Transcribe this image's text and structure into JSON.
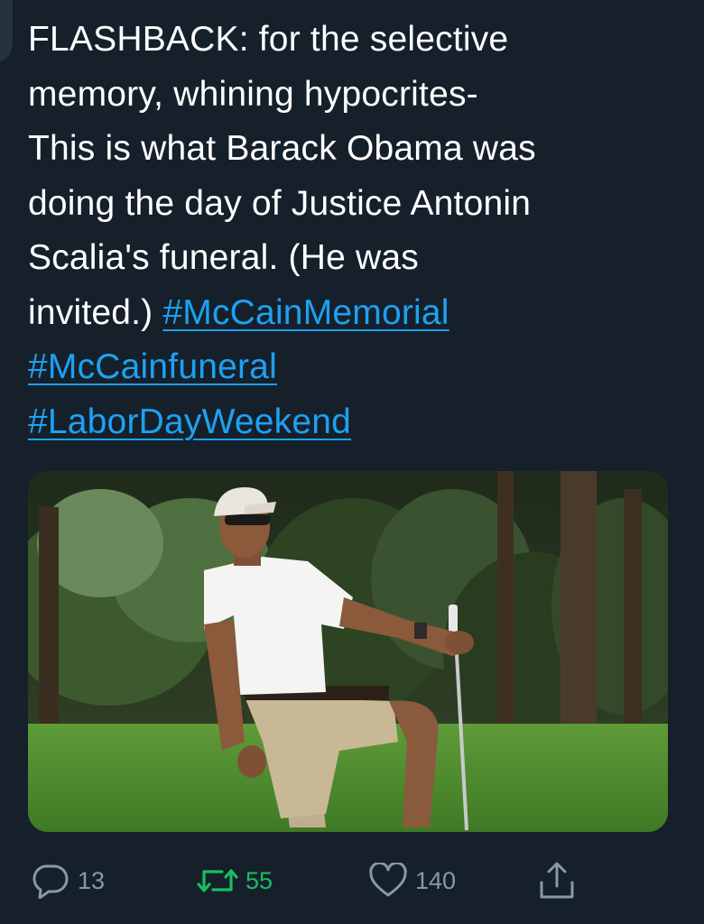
{
  "tweet": {
    "text_lines": [
      "FLASHBACK: for the selective",
      "memory, whining hypocrites-",
      "This is what Barack Obama was",
      "doing the day of Justice Antonin",
      "Scalia's funeral. (He was",
      "invited.) "
    ],
    "hashtags": [
      "#McCainMemorial",
      "#McCainfuneral",
      "#LaborDayWeekend"
    ]
  },
  "actions": {
    "reply": {
      "icon": "reply-bubble-icon",
      "count": "13"
    },
    "retweet": {
      "icon": "retweet-arrows-icon",
      "count": "55",
      "color": "#17bf63"
    },
    "like": {
      "icon": "heart-outline-icon",
      "count": "140"
    },
    "share": {
      "icon": "share-upload-icon"
    }
  },
  "colors": {
    "background": "#15202b",
    "text": "#ffffff",
    "link": "#1da1f2",
    "muted": "#8899a6",
    "retweet": "#17bf63"
  }
}
